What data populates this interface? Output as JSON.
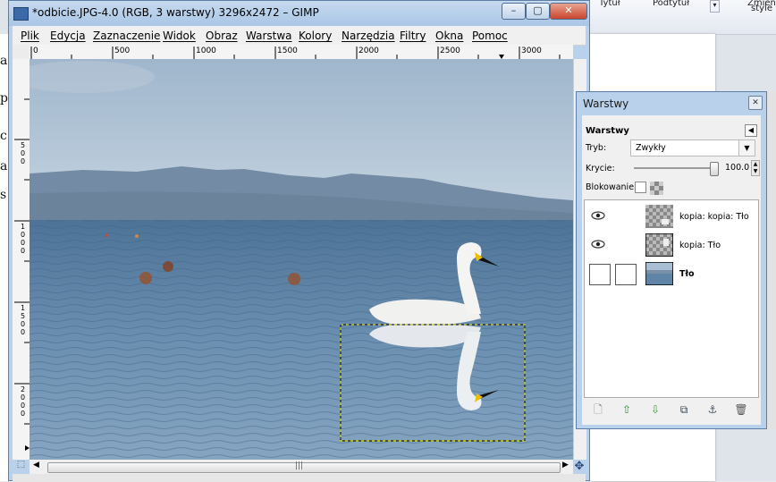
{
  "background_app": {
    "ribbon_items": [
      "Tytuł",
      "Podtytuł",
      "Zmień",
      "style"
    ],
    "left_letters": [
      "a",
      "p",
      "c",
      "a",
      "s"
    ]
  },
  "gimp_window": {
    "title": "*odbicie.JPG-4.0 (RGB, 3 warstwy) 3296x2472 – GIMP",
    "window_buttons": {
      "minimize": "–",
      "maximize": "▢",
      "close": "✕"
    },
    "menu": [
      "Plik",
      "Edycja",
      "Zaznaczenie",
      "Widok",
      "Obraz",
      "Warstwa",
      "Kolory",
      "Narzędzia",
      "Filtry",
      "Okna",
      "Pomoc"
    ],
    "hruler_labels": [
      "0",
      "500",
      "1000",
      "1500",
      "2000",
      "2500",
      "3000"
    ],
    "vruler_labels": [
      "5\n0\n0",
      "1\n0\n0\n0",
      "1\n5\n0\n0",
      "2\n0\n0\n0"
    ],
    "scroll_center": "|||"
  },
  "layers_dialog": {
    "title": "Warstwy",
    "close": "✕",
    "header": "Warstwy",
    "mode_label": "Tryb:",
    "mode_value": "Zwykły",
    "opacity_label": "Krycie:",
    "opacity_value": "100.0",
    "opacity_fraction": 1.0,
    "lock_label": "Blokowanie:",
    "layers": [
      {
        "name": "kopia: kopia: Tło",
        "visible": true,
        "active": false
      },
      {
        "name": "kopia: Tło",
        "visible": true,
        "active": false
      },
      {
        "name": "Tło",
        "visible": false,
        "active": true
      }
    ],
    "bottom_buttons": [
      "new-layer-icon",
      "raise-layer-icon",
      "lower-layer-icon",
      "duplicate-layer-icon",
      "anchor-layer-icon",
      "delete-layer-icon"
    ]
  },
  "colors": {
    "window_frame": "#b9d1ea",
    "selection": "#c8c800",
    "sea": "#5f85a6",
    "sky": "#a8bfd3"
  }
}
